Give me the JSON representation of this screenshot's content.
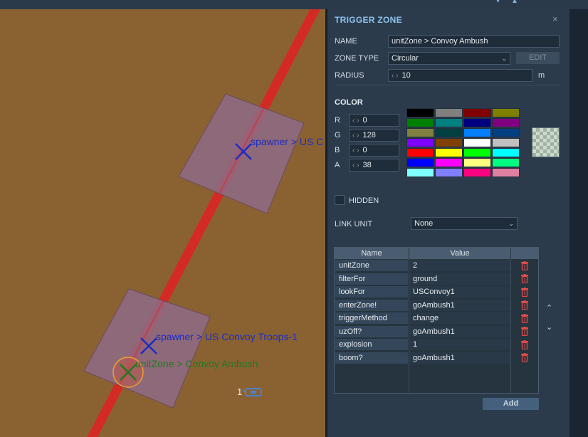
{
  "topbar": {
    "icons": [
      "map-marker-icon",
      "map-marker-icon"
    ]
  },
  "map": {
    "labels": {
      "spawner_1": "spawner > US C",
      "spawner_2": "spawner > US Convoy Troops-1",
      "unit_zone": "unitZone > Convoy Ambush",
      "unit_count": "1"
    },
    "colors": {
      "terrain": "#8a6232",
      "road": "#d42a24",
      "zone_fill": "#8e6b86",
      "spawner_marker": "#1b2cc6",
      "unitzone_marker": "#1f7a1f",
      "trigger_circle": "#f0a030"
    }
  },
  "panel": {
    "title": "TRIGGER ZONE",
    "close_glyph": "×",
    "name_label": "NAME",
    "name_value": "unitZone > Convoy Ambush",
    "zone_type_label": "ZONE TYPE",
    "zone_type_value": "Circular",
    "edit_label": "EDIT",
    "radius_label": "RADIUS",
    "radius_value": "10",
    "radius_unit": "m",
    "color_title": "COLOR",
    "rgba": [
      {
        "label": "R",
        "value": "0"
      },
      {
        "label": "G",
        "value": "128"
      },
      {
        "label": "B",
        "value": "0"
      },
      {
        "label": "A",
        "value": "38"
      }
    ],
    "palette": [
      "#000000",
      "#808080",
      "#800000",
      "#808000",
      "#008000",
      "#008080",
      "#000080",
      "#800080",
      "#808040",
      "#004040",
      "#0080ff",
      "#004080",
      "#8000ff",
      "#804000",
      "#ffffff",
      "#c0c0c0",
      "#ff0000",
      "#ffff00",
      "#00ff00",
      "#00ffff",
      "#0000ff",
      "#ff00ff",
      "#ffff80",
      "#00ff80",
      "#80ffff",
      "#8080ff",
      "#ff0080",
      "#e080a0"
    ],
    "hidden_label": "HIDDEN",
    "hidden_checked": false,
    "link_unit_label": "LINK UNIT",
    "link_unit_value": "None",
    "table": {
      "headers": [
        "Name",
        "Value"
      ],
      "rows": [
        {
          "name": "unitZone",
          "value": "2"
        },
        {
          "name": "filterFor",
          "value": "ground"
        },
        {
          "name": "lookFor",
          "value": "USConvoy1"
        },
        {
          "name": "enterZone!",
          "value": "goAmbush1"
        },
        {
          "name": "triggerMethod",
          "value": "change"
        },
        {
          "name": "uzOff?",
          "value": "goAmbush1"
        },
        {
          "name": "explosion",
          "value": "1"
        },
        {
          "name": "boom?",
          "value": "goAmbush1"
        }
      ]
    },
    "add_label": "Add",
    "scroll_up_glyph": "⌃",
    "scroll_down_glyph": "⌄"
  }
}
